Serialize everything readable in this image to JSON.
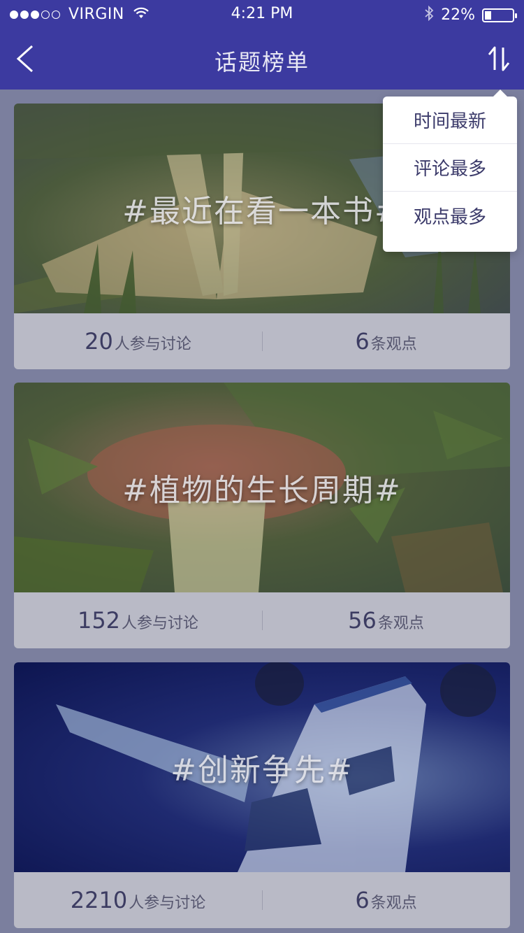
{
  "status_bar": {
    "carrier": "VIRGIN",
    "time": "4:21 PM",
    "battery": "22%",
    "signal_bars_filled": 3,
    "signal_bars_total": 5,
    "battery_level": 0.22
  },
  "navbar": {
    "title": "话题榜单",
    "back_icon": "chevron-left-icon",
    "sort_icon": "sort-arrows-icon"
  },
  "sort_menu": {
    "items": [
      "时间最新",
      "评论最多",
      "观点最多"
    ]
  },
  "topics": [
    {
      "tag": "#最近在看一本书#",
      "participants": "20",
      "participants_unit": "人参与讨论",
      "opinions": "6",
      "opinions_unit": "条观点",
      "image": "book-in-grass"
    },
    {
      "tag": "#植物的生长周期#",
      "participants": "152",
      "participants_unit": "人参与讨论",
      "opinions": "56",
      "opinions_unit": "条观点",
      "image": "mushroom-forest"
    },
    {
      "tag": "#创新争先#",
      "participants": "2210",
      "participants_unit": "人参与讨论",
      "opinions": "6",
      "opinions_unit": "条观点",
      "image": "airplane"
    }
  ],
  "colors": {
    "header": "#3c3aa0",
    "overlay": "#7b7f9e",
    "menu_text": "#3b3a6a"
  }
}
